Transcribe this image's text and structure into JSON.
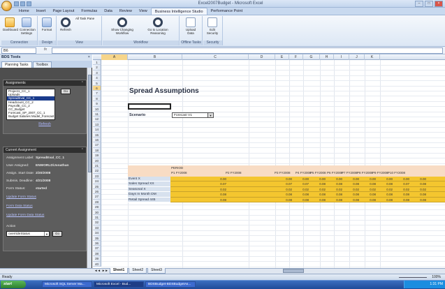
{
  "window": {
    "title": "Excel2007Budget - Microsoft Excel"
  },
  "ribbon_tabs": [
    "Home",
    "Insert",
    "Page Layout",
    "Formulas",
    "Data",
    "Review",
    "View",
    "Business Intelligence Studio",
    "Performance Point"
  ],
  "ribbon_groups": [
    {
      "label": "Connection",
      "buttons": [
        "Dashboard",
        "Connection Settings"
      ]
    },
    {
      "label": "Design",
      "buttons": [
        "Format"
      ]
    },
    {
      "label": "View",
      "buttons": [
        "Refresh",
        "All Task Pane"
      ]
    },
    {
      "label": "Workflow",
      "buttons": [
        "Show Changing Workflow",
        "Go to Location Reasoning"
      ]
    },
    {
      "label": "Offline Tasks",
      "buttons": [
        "Upload Data"
      ]
    },
    {
      "label": "Security",
      "buttons": [
        "Edit Security"
      ]
    }
  ],
  "formula_bar": {
    "name_box": "B6",
    "fx": "fx",
    "value": ""
  },
  "panel": {
    "title": "BDS Tools",
    "close": "×",
    "tabs": [
      "Planning Tasks",
      "Toolbox"
    ],
    "assignments": {
      "heading": "Assignments",
      "items": [
        "Project1_CC_1",
        "Uploads",
        "SpreadEval_CC_1",
        "Headcount_CC_2",
        "PayrollE_CC_2",
        "CC_Budget",
        "Forecast_SP_2007_CC_1",
        "Budget Salaries Model_Forecast"
      ],
      "selected_index": 2,
      "go": "Go",
      "refresh": "Refresh"
    },
    "current": {
      "heading": "Current Assignment",
      "fields": [
        {
          "k": "Assignment Label:",
          "v": "SpreadEval_CC_1"
        },
        {
          "k": "User Assigned:",
          "v": "ENWORLD\\Jonathan"
        },
        {
          "k": "Assign. Start Date:",
          "v": "2/20/2008"
        },
        {
          "k": "Submis. Deadline:",
          "v": "4/21/2008"
        },
        {
          "k": "Form Status:",
          "v": "started"
        }
      ],
      "links": [
        "Update Form Status",
        "Form Data Status",
        "Update Form Data Status"
      ],
      "action_label": "Action",
      "action_value": "overrideStatus",
      "action_go": "Go"
    }
  },
  "sheet": {
    "columns": [
      "A",
      "B",
      "C",
      "D",
      "E",
      "F",
      "G",
      "H",
      "I",
      "J",
      "K",
      "L"
    ],
    "rows": [
      "1",
      "2",
      "3",
      "4",
      "5",
      "6",
      "7",
      "8",
      "9",
      "10",
      "11",
      "12",
      "13",
      "14",
      "15",
      "16",
      "17",
      "18",
      "19",
      "20",
      "21",
      "22",
      "23",
      "24",
      "25",
      "26",
      "27",
      "28",
      "29",
      "30",
      "31",
      "32",
      "33",
      "34",
      "35",
      "36",
      "37",
      "38",
      "39",
      "40"
    ],
    "title": "Spread Assumptions",
    "scenario_label": "Scenario",
    "scenario_value": "Forecast V1",
    "table_header_top": "PERIOD",
    "periods": [
      "P1 FY2008",
      "P2 FY2008",
      "P3 FY2008",
      "P4 FY2008",
      "P5 FY2008",
      "P6 FY2008",
      "P7 FY2008",
      "P8 FY2008",
      "P9 FY2008",
      "P10 FY2008"
    ],
    "rows_data": [
      {
        "label": "Event X",
        "values": [
          "0.00",
          "0.00",
          "0.00",
          "0.00",
          "0.00",
          "0.00",
          "0.00",
          "0.00",
          "0.00",
          "0.00"
        ]
      },
      {
        "label": "Sales Spread XX",
        "values": [
          "0.07",
          "0.07",
          "0.07",
          "0.08",
          "0.08",
          "0.08",
          "0.08",
          "0.08",
          "0.07",
          "0.08"
        ]
      },
      {
        "label": "Seasonal X",
        "values": [
          "0.02",
          "0.02",
          "0.02",
          "0.02",
          "0.02",
          "0.02",
          "0.02",
          "0.02",
          "0.02",
          "0.02"
        ]
      },
      {
        "label": "Days In Month DM",
        "values": [
          "0.08",
          "0.08",
          "0.08",
          "0.08",
          "0.08",
          "0.08",
          "0.08",
          "0.08",
          "0.08",
          "0.08"
        ]
      },
      {
        "label": "Retail Spread 445",
        "values": [
          "0.08",
          "0.08",
          "0.08",
          "0.08",
          "0.08",
          "0.08",
          "0.08",
          "0.08",
          "0.08",
          "0.08"
        ]
      }
    ]
  },
  "sheet_tabs": [
    "Sheet1",
    "Sheet2",
    "Sheet3"
  ],
  "status": {
    "text": "Ready",
    "zoom": "100%"
  },
  "taskbar": {
    "start": "start",
    "items": [
      "Microsoft SQL Server Ma...",
      "Microsoft Excel - Bud...",
      "BDSBudget-BDSBudgetAs..."
    ],
    "active_index": 1,
    "clock": "1:31 PM"
  }
}
